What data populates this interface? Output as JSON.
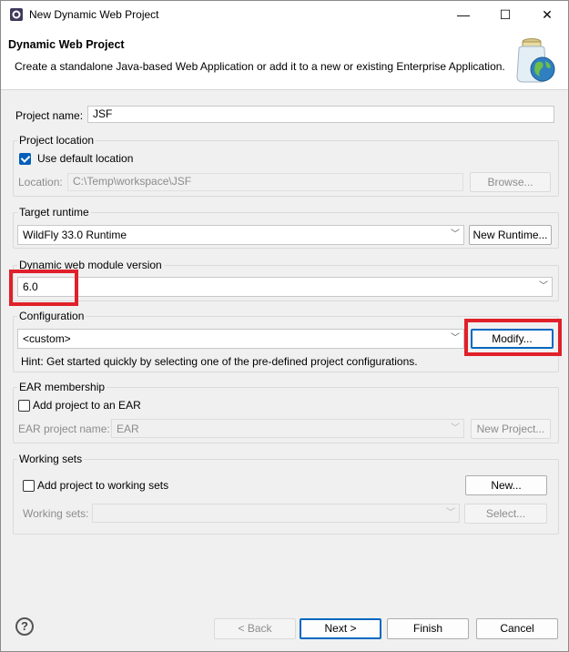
{
  "window": {
    "title": "New Dynamic Web Project",
    "minimize_glyph": "—",
    "maximize_glyph": "☐",
    "close_glyph": "✕"
  },
  "header": {
    "title": "Dynamic Web Project",
    "description": "Create a standalone Java-based Web Application or add it to a new or existing Enterprise Application."
  },
  "project_name": {
    "label": "Project name:",
    "value": "JSF"
  },
  "project_location": {
    "group_label": "Project location",
    "use_default_label": "Use default location",
    "use_default_checked": true,
    "location_label": "Location:",
    "location_value": "C:\\Temp\\workspace\\JSF",
    "browse_label": "Browse..."
  },
  "target_runtime": {
    "group_label": "Target runtime",
    "value": "WildFly 33.0 Runtime",
    "new_runtime_label": "New Runtime..."
  },
  "module_version": {
    "group_label": "Dynamic web module version",
    "value": "6.0"
  },
  "configuration": {
    "group_label": "Configuration",
    "value": "<custom>",
    "modify_label": "Modify...",
    "hint": "Hint: Get started quickly by selecting one of the pre-defined project configurations."
  },
  "ear": {
    "group_label": "EAR membership",
    "add_label": "Add project to an EAR",
    "add_checked": false,
    "project_name_label": "EAR project name:",
    "project_name_value": "EAR",
    "new_project_label": "New Project..."
  },
  "working_sets": {
    "group_label": "Working sets",
    "add_label": "Add project to working sets",
    "add_checked": false,
    "new_label": "New...",
    "sets_label": "Working sets:",
    "sets_value": "",
    "select_label": "Select..."
  },
  "footer": {
    "help_glyph": "?",
    "back_label": "< Back",
    "next_label": "Next >",
    "finish_label": "Finish",
    "cancel_label": "Cancel"
  },
  "colors": {
    "highlight": "#e0202a",
    "accent": "#0067c0"
  },
  "icons": [
    "app-icon",
    "minimize-icon",
    "maximize-icon",
    "close-icon",
    "project-jar-globe-icon",
    "help-icon",
    "chevron-down-icon"
  ]
}
